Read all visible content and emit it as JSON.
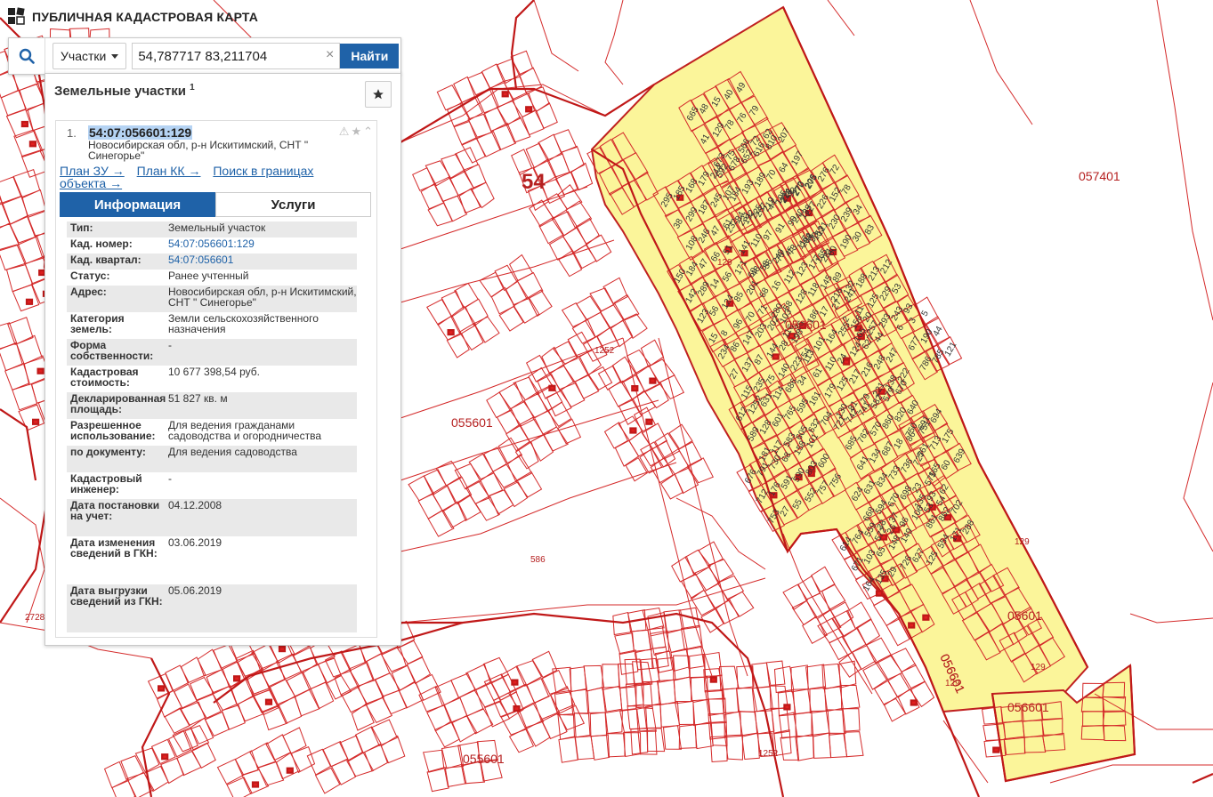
{
  "app": {
    "title": "ПУБЛИЧНАЯ КАДАСТРОВАЯ КАРТА"
  },
  "search": {
    "type_label": "Участки",
    "query": "54,787717 83,211704",
    "find_label": "Найти"
  },
  "results": {
    "title": "Земельные участки",
    "count": "1",
    "items": [
      {
        "index": "1.",
        "cad_number": "54:07:056601:129",
        "address": "Новосибирская обл, р-н Искитимский, СНТ \" Синегорье\"",
        "links": [
          "План ЗУ →",
          "План КК →",
          "Поиск в границах объекта →"
        ],
        "tabs": [
          "Информация",
          "Услуги"
        ],
        "info": [
          {
            "key": "Тип:",
            "value": "Земельный участок"
          },
          {
            "key": "Кад. номер:",
            "value": "54:07:056601:129"
          },
          {
            "key": "Кад. квартал:",
            "value": "54:07:056601"
          },
          {
            "key": "Статус:",
            "value": "Ранее учтенный"
          },
          {
            "key": "Адрес:",
            "value": "Новосибирская обл, р-н Искитимский, СНТ \" Синегорье\""
          },
          {
            "key": "Категория земель:",
            "value": "Земли сельскохозяйственного назначения"
          },
          {
            "key": "Форма собственности:",
            "value": "-"
          },
          {
            "key": "Кадастровая стоимость:",
            "value": "10 677 398,54 руб."
          },
          {
            "key": "Декларированная площадь:",
            "value": "51 827 кв. м"
          },
          {
            "key": "Разрешенное использование:",
            "value": "Для ведения гражданами садоводства и огородничества"
          },
          {
            "key": "по документу:",
            "value": "Для ведения садоводства"
          },
          {
            "key": "Кадастровый инженер:",
            "value": "-"
          },
          {
            "key": "Дата постановки на учет:",
            "value": "04.12.2008"
          },
          {
            "key": "Дата изменения сведений в ГКН:",
            "value": "03.06.2019"
          },
          {
            "key": "Дата выгрузки сведений из ГКН:",
            "value": "05.06.2019"
          }
        ]
      }
    ]
  },
  "map": {
    "region_label": "54",
    "quarter_labels": [
      "057401",
      "056601",
      "055601",
      "055601",
      "05601",
      "056601",
      "056601",
      "056601",
      "586",
      "1252",
      "1252",
      "2728",
      "129",
      "129",
      "129",
      "129"
    ],
    "lot_labels": [
      "665",
      "48",
      "15",
      "40",
      "49",
      "41",
      "129",
      "78",
      "76",
      "79",
      "673",
      "75",
      "566",
      "72",
      "62",
      "592",
      "678",
      "652",
      "616",
      "810",
      "207",
      "184",
      "193",
      "189",
      "70",
      "64",
      "197",
      "192",
      "267",
      "44",
      "224",
      "272",
      "206",
      "295",
      "185",
      "168",
      "179",
      "244",
      "38",
      "299",
      "187",
      "245",
      "107",
      "108",
      "246",
      "47",
      "61",
      "84",
      "232",
      "231",
      "225",
      "219",
      "195",
      "93",
      "141",
      "110",
      "97",
      "91",
      "90",
      "129",
      "48",
      "56",
      "75",
      "73",
      "204",
      "153",
      "218",
      "270",
      "275",
      "276",
      "72",
      "240",
      "227",
      "226",
      "152",
      "78",
      "88",
      "121",
      "230",
      "239",
      "34",
      "165",
      "60",
      "190",
      "30",
      "83",
      "150",
      "184",
      "47",
      "66",
      "51",
      "142",
      "289",
      "14",
      "56",
      "171",
      "123",
      "56",
      "124",
      "85",
      "201",
      "15",
      "8",
      "96",
      "70",
      "71",
      "69",
      "58",
      "249",
      "45",
      "117",
      "93",
      "68",
      "16",
      "112",
      "123",
      "177",
      "281",
      "280",
      "58",
      "128",
      "118",
      "145",
      "89",
      "116",
      "36",
      "186",
      "17",
      "27",
      "241",
      "216",
      "132",
      "188",
      "213",
      "212",
      "2",
      "11",
      "125",
      "229",
      "53",
      "105",
      "257",
      "293",
      "243",
      "93",
      "234",
      "86",
      "147",
      "203",
      "202",
      "103",
      "27",
      "137",
      "87",
      "144",
      "28",
      "198",
      "115",
      "235",
      "75",
      "140",
      "223",
      "113",
      "54",
      "101",
      "164",
      "255",
      "156",
      "20",
      "61",
      "110",
      "24",
      "124",
      "627",
      "44",
      "179",
      "125",
      "217",
      "216",
      "248",
      "247",
      "130",
      "81",
      "79",
      "221",
      "138",
      "222",
      "6",
      "3",
      "5",
      "677",
      "190",
      "44",
      "786",
      "785",
      "121",
      "612",
      "1252",
      "631",
      "114",
      "686",
      "34",
      "589",
      "128",
      "601",
      "765",
      "595",
      "161",
      "181",
      "117",
      "583",
      "605",
      "632",
      "704",
      "721",
      "742",
      "741",
      "582",
      "579",
      "670",
      "685",
      "762",
      "570",
      "860",
      "820",
      "640",
      "641",
      "134",
      "687",
      "18",
      "86",
      "751",
      "750",
      "691",
      "694",
      "561",
      "713",
      "175",
      "165",
      "60",
      "639",
      "676",
      "791",
      "730",
      "68",
      "158",
      "101",
      "712",
      "176",
      "591",
      "590",
      "803",
      "600",
      "753",
      "27",
      "55",
      "552",
      "757",
      "756",
      "624",
      "631",
      "834",
      "733",
      "736",
      "727",
      "668",
      "594",
      "670",
      "698",
      "23",
      "575",
      "572",
      "26",
      "96",
      "106",
      "53",
      "54",
      "135",
      "93",
      "62",
      "861",
      "862",
      "702",
      "554",
      "171",
      "288",
      "614",
      "764",
      "559",
      "38",
      "37",
      "671",
      "103",
      "65",
      "148",
      "149",
      "164",
      "135",
      "29",
      "726",
      "627",
      "125"
    ]
  }
}
